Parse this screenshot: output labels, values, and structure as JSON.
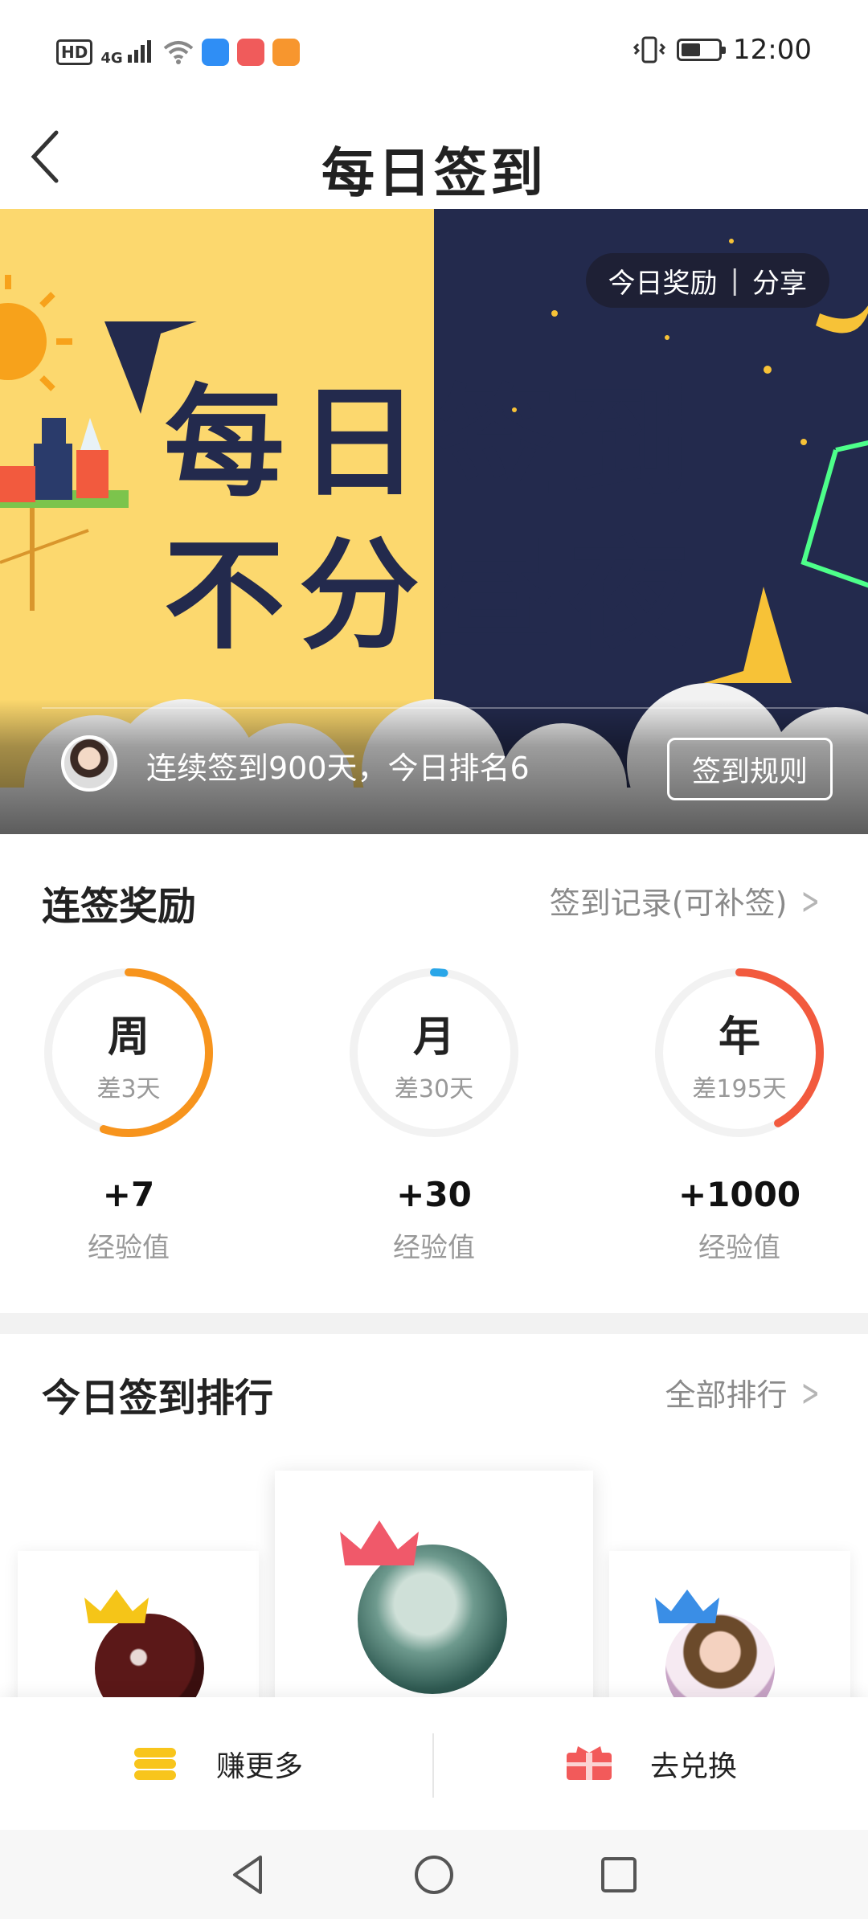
{
  "status_bar": {
    "time": "12:00",
    "network_label": "HD",
    "signal_label": "4G",
    "battery_level": 0.45,
    "icons": [
      "hd-icon",
      "signal-icon",
      "wifi-icon",
      "app-icon-blue",
      "app-icon-red",
      "app-icon-orange",
      "vibrate-icon",
      "battery-icon"
    ]
  },
  "header": {
    "title": "每日签到",
    "back_icon": "back-arrow-icon"
  },
  "banner": {
    "headline_1": "每日签到",
    "headline_2": "不分昼夜",
    "chip_reward": "今日奖励",
    "chip_separator": "|",
    "chip_share": "分享",
    "streak_text": "连续签到900天，今日排名6",
    "rules_button": "签到规则",
    "colors": {
      "day": "#fcd86e",
      "night": "#232a4d",
      "text": "#232a4d"
    }
  },
  "rewards": {
    "title": "连签奖励",
    "link": "签到记录(可补签)",
    "items": [
      {
        "label": "周",
        "remaining": "差3天",
        "bonus": "+7",
        "unit": "经验值",
        "progress": 0.55,
        "color": "#f7941d"
      },
      {
        "label": "月",
        "remaining": "差30天",
        "bonus": "+30",
        "unit": "经验值",
        "progress": 0.02,
        "color": "#29a6e8"
      },
      {
        "label": "年",
        "remaining": "差195天",
        "bonus": "+1000",
        "unit": "经验值",
        "progress": 0.42,
        "color": "#f25a3e"
      }
    ]
  },
  "ranking": {
    "title": "今日签到排行",
    "link": "全部排行",
    "crown_colors": [
      "#f5c518",
      "#f0596a",
      "#3a8ee6"
    ]
  },
  "actions": {
    "earn_more": "赚更多",
    "redeem": "去兑换"
  },
  "nav": {
    "icons": [
      "nav-back-icon",
      "nav-home-icon",
      "nav-recents-icon"
    ]
  }
}
